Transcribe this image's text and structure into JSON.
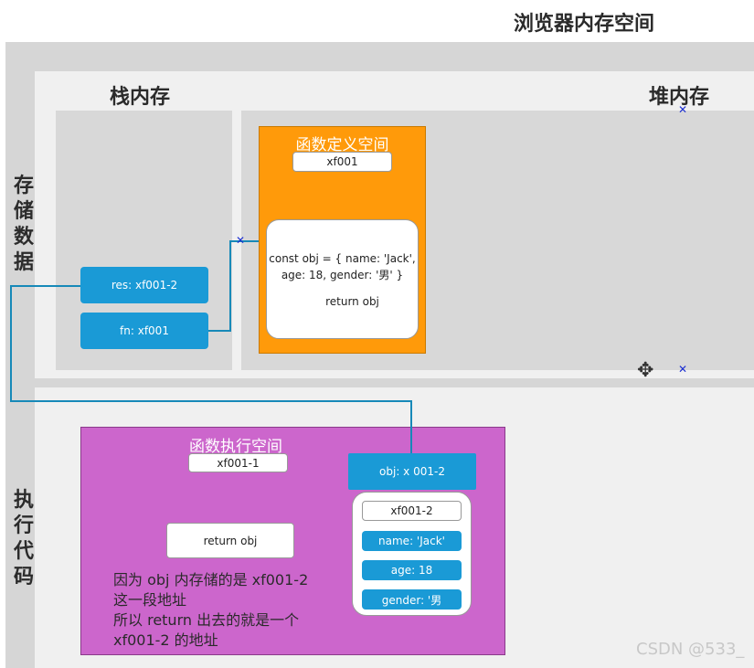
{
  "page_title": "浏览器内存空间",
  "sections": {
    "store_data": "存储数据",
    "exec_code": "执行代码",
    "stack": "栈内存",
    "heap": "堆内存"
  },
  "stack_items": {
    "res": "res: xf001-2",
    "fn": "fn: xf001"
  },
  "func_def": {
    "title": "函数定义空间",
    "address": "xf001",
    "code_line1": "const obj = { name: 'Jack',",
    "code_line2": "age: 18, gender: '男' }",
    "code_return": "return obj"
  },
  "func_exec": {
    "title": "函数执行空间",
    "address": "xf001-1",
    "return_label": "return obj",
    "obj_ref": "obj: x 001-2",
    "note_lines": [
      "因为 obj 内存储的是 xf001-2",
      "这一段地址",
      "所以 return 出去的就是一个",
      "xf001-2 的地址"
    ]
  },
  "obj_card": {
    "address": "xf001-2",
    "name": "name: 'Jack'",
    "age": "age: 18",
    "gender": "gender: '男"
  },
  "watermark": "CSDN @533_",
  "colors": {
    "orange": "#ff9a0a",
    "purple": "#cc66cc",
    "blue": "#1a9ad6",
    "connector": "#1789b8"
  }
}
